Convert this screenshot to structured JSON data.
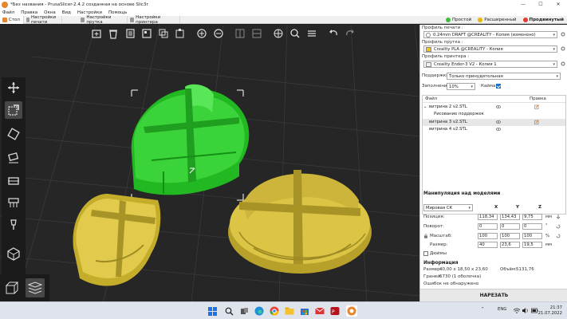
{
  "window": {
    "title": "*Без названия - PrusaSlicer-2.4.2 созданная на основе Slic3r",
    "controls": [
      "—",
      "☐",
      "✕"
    ]
  },
  "menu": [
    "Файл",
    "Правка",
    "Окна",
    "Вид",
    "Настройки",
    "Помощь"
  ],
  "tabs": [
    {
      "label": "Стол",
      "active": true
    },
    {
      "label": "Настройки печати",
      "active": false
    },
    {
      "label": "Настройки прутка",
      "active": false
    },
    {
      "label": "Настройки принтера",
      "active": false
    }
  ],
  "modes": [
    {
      "label": "Простой",
      "color": "#3fbf3f",
      "selected": false
    },
    {
      "label": "Расширенный",
      "color": "#e8b70b",
      "selected": false
    },
    {
      "label": "Продвинутый",
      "color": "#e33b2e",
      "selected": true
    }
  ],
  "top_toolbar_icons": [
    "add-icon",
    "delete-icon",
    "delete-all-icon",
    "arrange-icon",
    "copy-icon",
    "paste-icon",
    "add-instance-icon",
    "remove-instance-icon",
    "split-objects-icon",
    "split-parts-icon",
    "variable-layer-height-icon",
    "search-icon",
    "layers-editing-icon",
    "undo-icon",
    "redo-icon"
  ],
  "left_toolbar_icons": [
    "move-icon",
    "scale-icon",
    "rotate-icon",
    "place-on-face-icon",
    "cut-icon",
    "paint-supports-icon",
    "seam-painting-icon",
    "hollow-icon"
  ],
  "view_buttons": [
    "3d-view-icon",
    "preview-icon"
  ],
  "sidebar": {
    "print_profile_label": "Профиль печати :",
    "print_profile_value": "0.24mm DRAFT @CREALITY - Копия (изменено)",
    "filament_label": "Профиль прутка :",
    "filament_value": "Creality PLA @CREALITY - Копия",
    "filament_color": "#f5c318",
    "printer_label": "Профиль принтера :",
    "printer_value": "Creality Ender-3 V2 - Копия 1",
    "supports_label": "Поддержки:",
    "supports_value": "Только принудительная",
    "infill_label": "Заполнение:",
    "infill_value": "10%",
    "brim_label": "Кайма:",
    "brim_checked": true
  },
  "object_list": {
    "col_file": "Файл",
    "col_edit": "Правка",
    "rows": [
      {
        "name": "витрина 2 v2.STL",
        "level": 0,
        "expanded": true,
        "selected": false
      },
      {
        "name": "Рисование поддержек",
        "level": 1,
        "expanded": false,
        "selected": false
      },
      {
        "name": "витрина 3 v2.STL",
        "level": 0,
        "expanded": false,
        "selected": true
      },
      {
        "name": "витрина 4 v2.STL",
        "level": 0,
        "expanded": false,
        "selected": false
      }
    ]
  },
  "manipulation": {
    "title": "Манипуляция над моделями",
    "coord_system": "Мировая СК",
    "axes": [
      "X",
      "Y",
      "Z"
    ],
    "position_label": "Позиция:",
    "position": [
      "118,34",
      "134,43",
      "9,75"
    ],
    "position_unit": "мм",
    "rotation_label": "Поворот:",
    "rotation": [
      "0",
      "0",
      "0"
    ],
    "rotation_unit": "°",
    "scale_label": "Масштаб:",
    "scale": [
      "100",
      "100",
      "100"
    ],
    "scale_unit": "%",
    "size_label": "Размер:",
    "size": [
      "40",
      "23,6",
      "19,5"
    ],
    "size_unit": "мм",
    "inches_label": "Дюймы"
  },
  "info": {
    "title": "Информация",
    "size_label": "Размер:",
    "size_value": "40,00 x 18,50 x 23,60",
    "volume_label": "Объём:",
    "volume_value": "5131,76",
    "facets_label": "Граней:",
    "facets_value": "6730 (1 оболочка)",
    "errors_value": "Ошибок не обнаружено"
  },
  "slice_button": "НАРЕЗАТЬ",
  "taskbar": {
    "lang": "ENG",
    "time": "21:37",
    "date": "21.07.2022"
  },
  "colors": {
    "viewport_bg": "#262626",
    "selected_object": "#2fd42f",
    "object": "#d9c24a",
    "bed_grid": "#3c3c3c",
    "accent": "#e8852b"
  }
}
